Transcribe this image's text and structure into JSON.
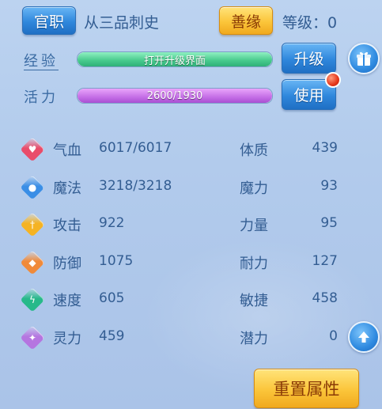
{
  "header": {
    "rank_button": "官职",
    "rank_title": "从三品刺史",
    "karma_button": "善缘",
    "level_label": "等级：0"
  },
  "exp": {
    "label": "经验",
    "bar_text": "打开升级界面",
    "fill_ratio": 1.0,
    "upgrade_button": "升级"
  },
  "vitality": {
    "label": "活力",
    "bar_text": "2600/1930",
    "fill_ratio": 1.0,
    "use_button": "使用"
  },
  "stats": [
    {
      "name": "气血",
      "value": "6017/6017",
      "icon": "heart-icon",
      "color": "#e94c6a"
    },
    {
      "name": "魔法",
      "value": "3218/3218",
      "icon": "magic-icon",
      "color": "#3a8ee6"
    },
    {
      "name": "攻击",
      "value": "922",
      "icon": "sword-icon",
      "color": "#f5b323"
    },
    {
      "name": "防御",
      "value": "1075",
      "icon": "shield-icon",
      "color": "#f08a3a"
    },
    {
      "name": "速度",
      "value": "605",
      "icon": "lightning-icon",
      "color": "#27b98a"
    },
    {
      "name": "灵力",
      "value": "459",
      "icon": "spirit-icon",
      "color": "#b575e0"
    }
  ],
  "attributes": [
    {
      "name": "体质",
      "value": "439"
    },
    {
      "name": "魔力",
      "value": "93"
    },
    {
      "name": "力量",
      "value": "95"
    },
    {
      "name": "耐力",
      "value": "127"
    },
    {
      "name": "敏捷",
      "value": "458"
    },
    {
      "name": "潜力",
      "value": "0"
    }
  ],
  "reset_button": "重置属性",
  "colors": {
    "exp_bar": "#4fd39a",
    "vitality_bar": "#c46ee6",
    "blue_button": "#2f87dc",
    "gold_button": "#fbc53a"
  }
}
